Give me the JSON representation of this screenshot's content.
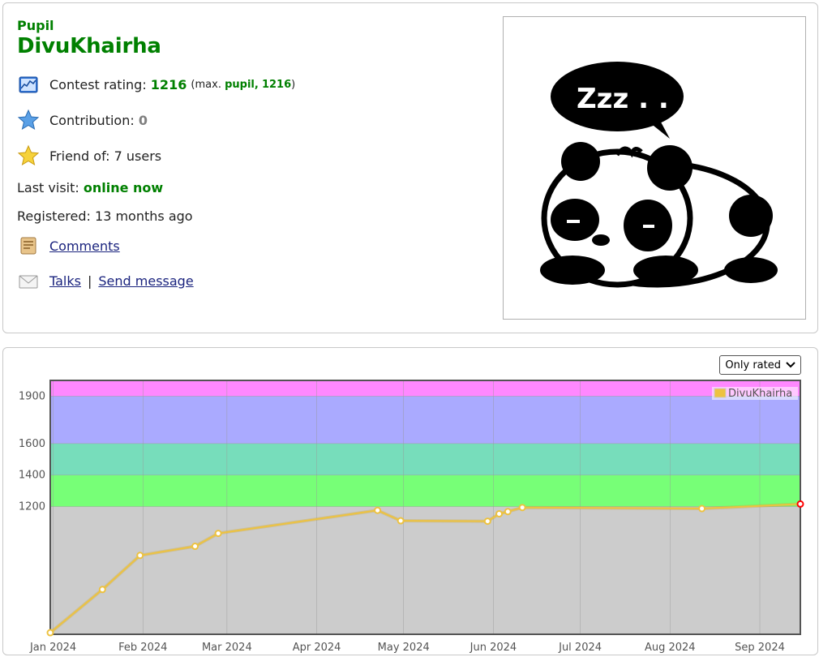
{
  "profile": {
    "rank": "Pupil",
    "handle": "DivuKhairha",
    "contest_rating_label": "Contest rating:",
    "contest_rating_value": "1216",
    "contest_rating_max_prefix": "(max.",
    "contest_rating_max_rank": "pupil,",
    "contest_rating_max_value": "1216",
    "contest_rating_max_suffix": ")",
    "contribution_label": "Contribution:",
    "contribution_value": "0",
    "friend_of_label": "Friend of:",
    "friend_of_value": "7 users",
    "last_visit_label": "Last visit:",
    "last_visit_value": "online now",
    "registered_label": "Registered:",
    "registered_value": "13 months ago",
    "comments_link": "Comments",
    "talks_link": "Talks",
    "separator": "|",
    "send_message_link": "Send message",
    "icons": [
      "rating-chart-icon",
      "star-blue-icon",
      "star-yellow-icon",
      "comments-icon",
      "envelope-icon"
    ]
  },
  "avatar": {
    "bubble_text": "Zzz . ."
  },
  "graph_controls": {
    "filter_select": "Only rated"
  },
  "chart_data": {
    "type": "line",
    "legend": "DivuKhairha",
    "legend_position": "top-right",
    "series_color": "#edc240",
    "last_point_color": "#ff0000",
    "x_ticks": [
      "Jan 2024",
      "Feb 2024",
      "Mar 2024",
      "Apr 2024",
      "May 2024",
      "Jun 2024",
      "Jul 2024",
      "Aug 2024",
      "Sep 2024"
    ],
    "y_ticks": [
      1200,
      1400,
      1600,
      1900
    ],
    "ylim": [
      390,
      2000
    ],
    "grid": true,
    "bands": [
      {
        "from": 0,
        "to": 1200,
        "color": "#cccccc"
      },
      {
        "from": 1200,
        "to": 1400,
        "color": "#77ff77"
      },
      {
        "from": 1400,
        "to": 1600,
        "color": "#77ddbb"
      },
      {
        "from": 1600,
        "to": 1900,
        "color": "#aaaaff"
      },
      {
        "from": 1900,
        "to": 2100,
        "color": "#ff88ff"
      }
    ],
    "points": [
      {
        "x": "2023-12-31",
        "y": 400
      },
      {
        "x": "2024-01-18",
        "y": 674
      },
      {
        "x": "2024-01-31",
        "y": 890
      },
      {
        "x": "2024-02-19",
        "y": 948
      },
      {
        "x": "2024-02-27",
        "y": 1030
      },
      {
        "x": "2024-04-22",
        "y": 1176
      },
      {
        "x": "2024-04-30",
        "y": 1110
      },
      {
        "x": "2024-05-30",
        "y": 1107
      },
      {
        "x": "2024-06-03",
        "y": 1154
      },
      {
        "x": "2024-06-06",
        "y": 1168
      },
      {
        "x": "2024-06-11",
        "y": 1194
      },
      {
        "x": "2024-08-12",
        "y": 1187
      },
      {
        "x": "2024-09-15",
        "y": 1216
      }
    ]
  }
}
